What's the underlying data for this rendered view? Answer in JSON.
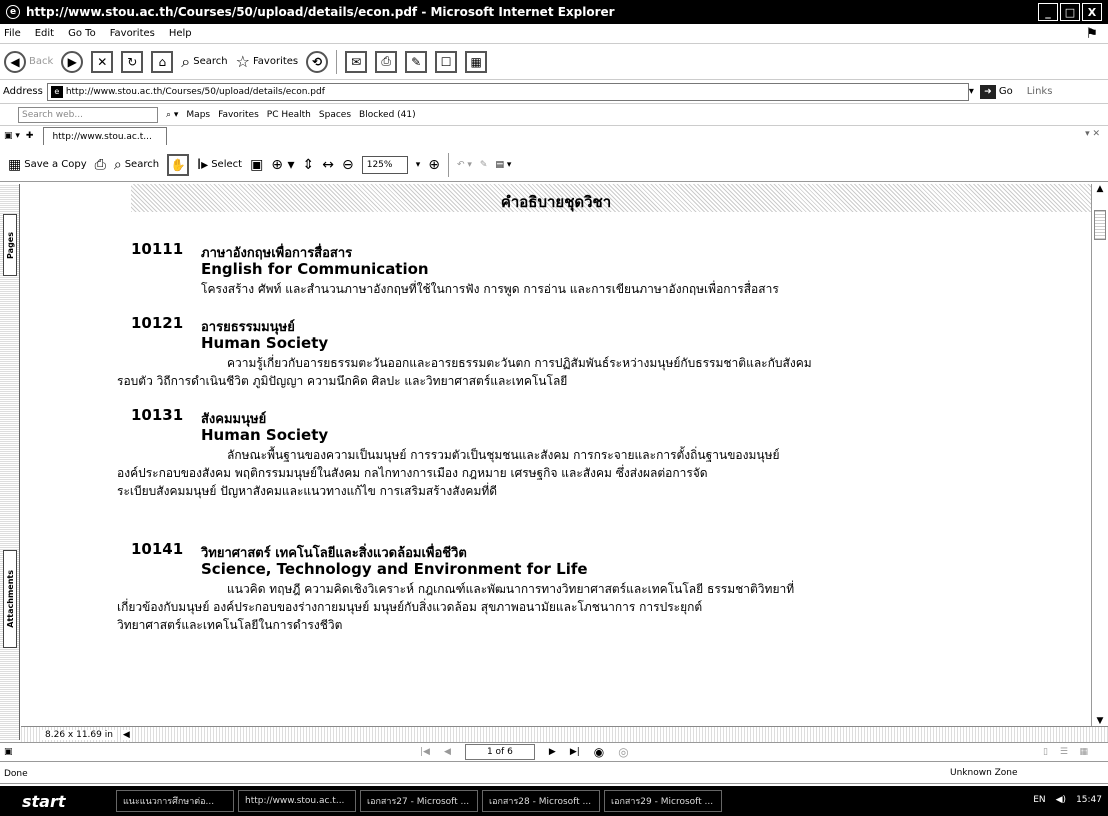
{
  "window": {
    "title": "http://www.stou.ac.th/Courses/50/upload/details/econ.pdf - Microsoft Internet Explorer",
    "minimize": "_",
    "maximize": "□",
    "close": "X"
  },
  "menu": [
    "File",
    "Edit",
    "Go To",
    "Favorites",
    "Help"
  ],
  "toolbar": {
    "back": "Back",
    "search": "Search",
    "favorites": "Favorites"
  },
  "address": {
    "label": "Address",
    "url": "http://www.stou.ac.th/Courses/50/upload/details/econ.pdf",
    "go": "Go",
    "links": "Links"
  },
  "msn": {
    "search_placeholder": "Search web...",
    "maps": "Maps",
    "favorites": "Favorites",
    "pc_health": "PC Health",
    "spaces": "Spaces",
    "blocked": "Blocked (41)"
  },
  "tab": {
    "label": "http://www.stou.ac.t..."
  },
  "acrobat": {
    "save_copy": "Save a Copy",
    "search": "Search",
    "select": "Select",
    "zoom": "125%"
  },
  "side": {
    "pages": "Pages",
    "attachments": "Attachments"
  },
  "document": {
    "heading": "คำอธิบายชุดวิชา",
    "courses": [
      {
        "code": "10111",
        "th": "ภาษาอังกฤษเพื่อการสื่อสาร",
        "en": "English for Communication",
        "desc_first": "โครงสร้าง ศัพท์ และสำนวนภาษาอังกฤษที่ใช้ในการฟัง การพูด การอ่าน และการเขียนภาษาอังกฤษเพื่อการสื่อสาร",
        "desc_rest": ""
      },
      {
        "code": "10121",
        "th": "อารยธรรมมนุษย์",
        "en": "Human Society",
        "desc_first": "ความรู้เกี่ยวกับอารยธรรมตะวันออกและอารยธรรมตะวันตก การปฏิสัมพันธ์ระหว่างมนุษย์กับธรรมชาติและกับสังคม",
        "desc_rest": "รอบตัว วิถีการดำเนินชีวิต ภูมิปัญญา ความนึกคิด ศิลปะ และวิทยาศาสตร์และเทคโนโลยี"
      },
      {
        "code": "10131",
        "th": "สังคมมนุษย์",
        "en": "Human Society",
        "desc_first": "ลักษณะพื้นฐานของความเป็นมนุษย์ การรวมตัวเป็นชุมชนและสังคม การกระจายและการตั้งถิ่นฐานของมนุษย์",
        "desc_rest": "องค์ประกอบของสังคม พฤติกรรมมนุษย์ในสังคม กลไกทางการเมือง กฎหมาย เศรษฐกิจ และสังคม ซึ่งส่งผลต่อการจัด\nระเบียบสังคมมนุษย์ ปัญหาสังคมและแนวทางแก้ไข การเสริมสร้างสังคมที่ดี"
      },
      {
        "code": "10141",
        "th": "วิทยาศาสตร์ เทคโนโลยีและสิ่งแวดล้อมเพื่อชีวิต",
        "en": "Science, Technology and Environment for Life",
        "desc_first": "แนวคิด ทฤษฎี ความคิดเชิงวิเคราะห์ กฎเกณฑ์และพัฒนาการทางวิทยาศาสตร์และเทคโนโลยี ธรรมชาติวิทยาที่",
        "desc_rest": "เกี่ยวข้องกับมนุษย์ องค์ประกอบของร่างกายมนุษย์ มนุษย์กับสิ่งแวดล้อม สุขภาพอนามัยและโภชนาการ การประยุกต์\nวิทยาศาสตร์และเทคโนโลยีในการดำรงชีวิต"
      }
    ]
  },
  "page_size": "8.26 x 11.69 in",
  "nav": {
    "page": "1 of 6"
  },
  "status": {
    "text": "Done",
    "zone": "Unknown Zone"
  },
  "taskbar": {
    "start": "start",
    "tasks": [
      "แนะแนวการศึกษาต่อ...",
      "http://www.stou.ac.t...",
      "เอกสาร27 - Microsoft ...",
      "เอกสาร28 - Microsoft ...",
      "เอกสาร29 - Microsoft ..."
    ],
    "lang": "EN",
    "time": "15:47"
  }
}
